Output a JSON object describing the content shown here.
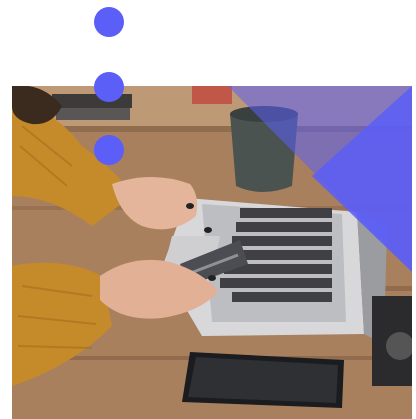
{
  "image": {
    "subject": "photo-laptop-card-phone"
  },
  "colors": {
    "accent": "#5b5ef7",
    "background": "#ffffff"
  },
  "decorations": {
    "dots": [
      "dot",
      "dot",
      "dot"
    ],
    "overlay": "blue-triangle-overlay"
  }
}
